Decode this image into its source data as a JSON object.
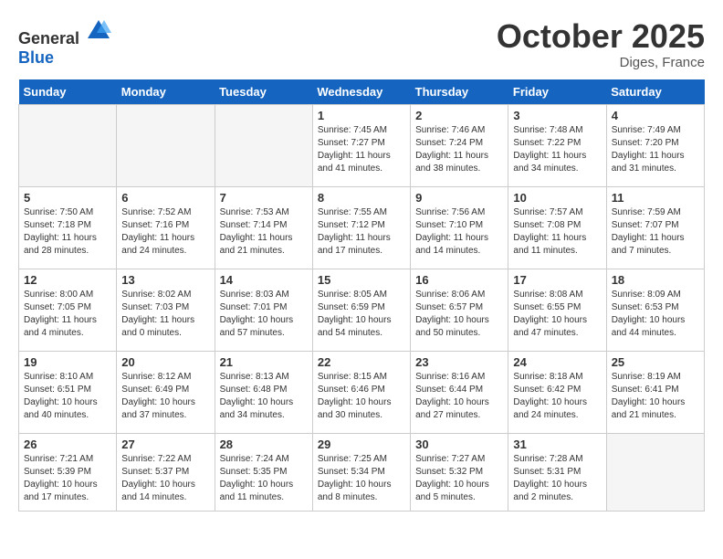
{
  "header": {
    "logo_general": "General",
    "logo_blue": "Blue",
    "month": "October 2025",
    "location": "Diges, France"
  },
  "weekdays": [
    "Sunday",
    "Monday",
    "Tuesday",
    "Wednesday",
    "Thursday",
    "Friday",
    "Saturday"
  ],
  "weeks": [
    [
      {
        "day": "",
        "empty": true
      },
      {
        "day": "",
        "empty": true
      },
      {
        "day": "",
        "empty": true
      },
      {
        "day": "1",
        "sunrise": "Sunrise: 7:45 AM",
        "sunset": "Sunset: 7:27 PM",
        "daylight": "Daylight: 11 hours and 41 minutes."
      },
      {
        "day": "2",
        "sunrise": "Sunrise: 7:46 AM",
        "sunset": "Sunset: 7:24 PM",
        "daylight": "Daylight: 11 hours and 38 minutes."
      },
      {
        "day": "3",
        "sunrise": "Sunrise: 7:48 AM",
        "sunset": "Sunset: 7:22 PM",
        "daylight": "Daylight: 11 hours and 34 minutes."
      },
      {
        "day": "4",
        "sunrise": "Sunrise: 7:49 AM",
        "sunset": "Sunset: 7:20 PM",
        "daylight": "Daylight: 11 hours and 31 minutes."
      }
    ],
    [
      {
        "day": "5",
        "sunrise": "Sunrise: 7:50 AM",
        "sunset": "Sunset: 7:18 PM",
        "daylight": "Daylight: 11 hours and 28 minutes."
      },
      {
        "day": "6",
        "sunrise": "Sunrise: 7:52 AM",
        "sunset": "Sunset: 7:16 PM",
        "daylight": "Daylight: 11 hours and 24 minutes."
      },
      {
        "day": "7",
        "sunrise": "Sunrise: 7:53 AM",
        "sunset": "Sunset: 7:14 PM",
        "daylight": "Daylight: 11 hours and 21 minutes."
      },
      {
        "day": "8",
        "sunrise": "Sunrise: 7:55 AM",
        "sunset": "Sunset: 7:12 PM",
        "daylight": "Daylight: 11 hours and 17 minutes."
      },
      {
        "day": "9",
        "sunrise": "Sunrise: 7:56 AM",
        "sunset": "Sunset: 7:10 PM",
        "daylight": "Daylight: 11 hours and 14 minutes."
      },
      {
        "day": "10",
        "sunrise": "Sunrise: 7:57 AM",
        "sunset": "Sunset: 7:08 PM",
        "daylight": "Daylight: 11 hours and 11 minutes."
      },
      {
        "day": "11",
        "sunrise": "Sunrise: 7:59 AM",
        "sunset": "Sunset: 7:07 PM",
        "daylight": "Daylight: 11 hours and 7 minutes."
      }
    ],
    [
      {
        "day": "12",
        "sunrise": "Sunrise: 8:00 AM",
        "sunset": "Sunset: 7:05 PM",
        "daylight": "Daylight: 11 hours and 4 minutes."
      },
      {
        "day": "13",
        "sunrise": "Sunrise: 8:02 AM",
        "sunset": "Sunset: 7:03 PM",
        "daylight": "Daylight: 11 hours and 0 minutes."
      },
      {
        "day": "14",
        "sunrise": "Sunrise: 8:03 AM",
        "sunset": "Sunset: 7:01 PM",
        "daylight": "Daylight: 10 hours and 57 minutes."
      },
      {
        "day": "15",
        "sunrise": "Sunrise: 8:05 AM",
        "sunset": "Sunset: 6:59 PM",
        "daylight": "Daylight: 10 hours and 54 minutes."
      },
      {
        "day": "16",
        "sunrise": "Sunrise: 8:06 AM",
        "sunset": "Sunset: 6:57 PM",
        "daylight": "Daylight: 10 hours and 50 minutes."
      },
      {
        "day": "17",
        "sunrise": "Sunrise: 8:08 AM",
        "sunset": "Sunset: 6:55 PM",
        "daylight": "Daylight: 10 hours and 47 minutes."
      },
      {
        "day": "18",
        "sunrise": "Sunrise: 8:09 AM",
        "sunset": "Sunset: 6:53 PM",
        "daylight": "Daylight: 10 hours and 44 minutes."
      }
    ],
    [
      {
        "day": "19",
        "sunrise": "Sunrise: 8:10 AM",
        "sunset": "Sunset: 6:51 PM",
        "daylight": "Daylight: 10 hours and 40 minutes."
      },
      {
        "day": "20",
        "sunrise": "Sunrise: 8:12 AM",
        "sunset": "Sunset: 6:49 PM",
        "daylight": "Daylight: 10 hours and 37 minutes."
      },
      {
        "day": "21",
        "sunrise": "Sunrise: 8:13 AM",
        "sunset": "Sunset: 6:48 PM",
        "daylight": "Daylight: 10 hours and 34 minutes."
      },
      {
        "day": "22",
        "sunrise": "Sunrise: 8:15 AM",
        "sunset": "Sunset: 6:46 PM",
        "daylight": "Daylight: 10 hours and 30 minutes."
      },
      {
        "day": "23",
        "sunrise": "Sunrise: 8:16 AM",
        "sunset": "Sunset: 6:44 PM",
        "daylight": "Daylight: 10 hours and 27 minutes."
      },
      {
        "day": "24",
        "sunrise": "Sunrise: 8:18 AM",
        "sunset": "Sunset: 6:42 PM",
        "daylight": "Daylight: 10 hours and 24 minutes."
      },
      {
        "day": "25",
        "sunrise": "Sunrise: 8:19 AM",
        "sunset": "Sunset: 6:41 PM",
        "daylight": "Daylight: 10 hours and 21 minutes."
      }
    ],
    [
      {
        "day": "26",
        "sunrise": "Sunrise: 7:21 AM",
        "sunset": "Sunset: 5:39 PM",
        "daylight": "Daylight: 10 hours and 17 minutes."
      },
      {
        "day": "27",
        "sunrise": "Sunrise: 7:22 AM",
        "sunset": "Sunset: 5:37 PM",
        "daylight": "Daylight: 10 hours and 14 minutes."
      },
      {
        "day": "28",
        "sunrise": "Sunrise: 7:24 AM",
        "sunset": "Sunset: 5:35 PM",
        "daylight": "Daylight: 10 hours and 11 minutes."
      },
      {
        "day": "29",
        "sunrise": "Sunrise: 7:25 AM",
        "sunset": "Sunset: 5:34 PM",
        "daylight": "Daylight: 10 hours and 8 minutes."
      },
      {
        "day": "30",
        "sunrise": "Sunrise: 7:27 AM",
        "sunset": "Sunset: 5:32 PM",
        "daylight": "Daylight: 10 hours and 5 minutes."
      },
      {
        "day": "31",
        "sunrise": "Sunrise: 7:28 AM",
        "sunset": "Sunset: 5:31 PM",
        "daylight": "Daylight: 10 hours and 2 minutes."
      },
      {
        "day": "",
        "empty": true
      }
    ]
  ]
}
